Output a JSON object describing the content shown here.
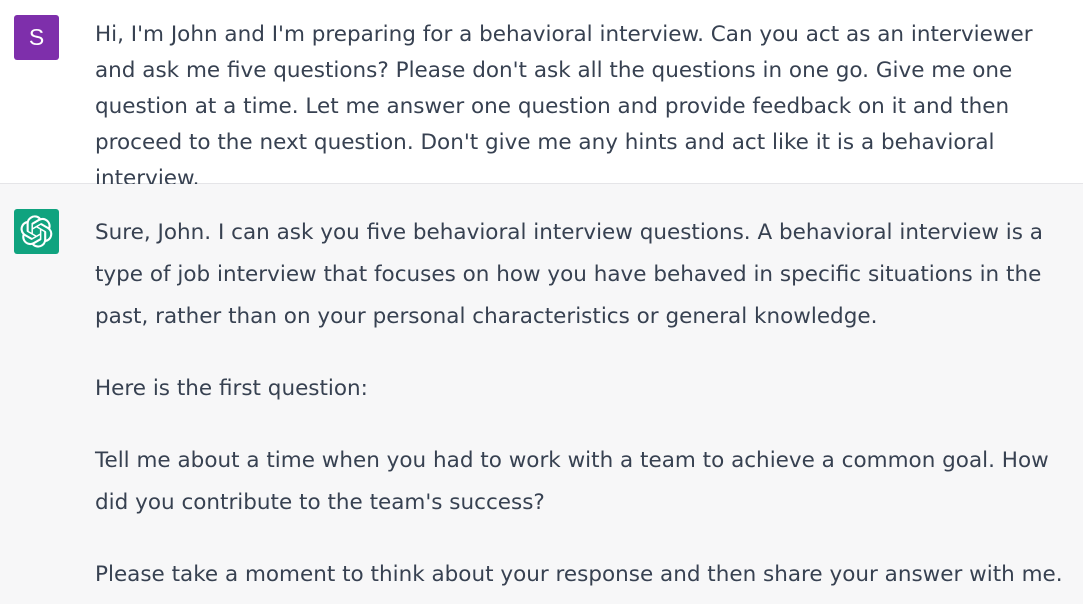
{
  "user_message": {
    "avatar_letter": "S",
    "avatar_color": "#7e2fab",
    "text": "Hi, I'm John and I'm preparing for a behavioral interview. Can you act as an interviewer and ask me five questions? Please don't ask all the questions in one go. Give me one question at a time. Let me answer one question and provide feedback on it and then proceed to the next question. Don't give me any hints and act like it is a behavioral interview."
  },
  "assistant_message": {
    "avatar_icon": "openai-logo-icon",
    "avatar_color": "#10a37f",
    "paragraphs": [
      "Sure, John. I can ask you five behavioral interview questions. A behavioral interview is a type of job interview that focuses on how you have behaved in specific situations in the past, rather than on your personal characteristics or general knowledge.",
      "Here is the first question:",
      "Tell me about a time when you had to work with a team to achieve a common goal. How did you contribute to the team's success?",
      "Please take a moment to think about your response and then share your answer with me."
    ]
  }
}
